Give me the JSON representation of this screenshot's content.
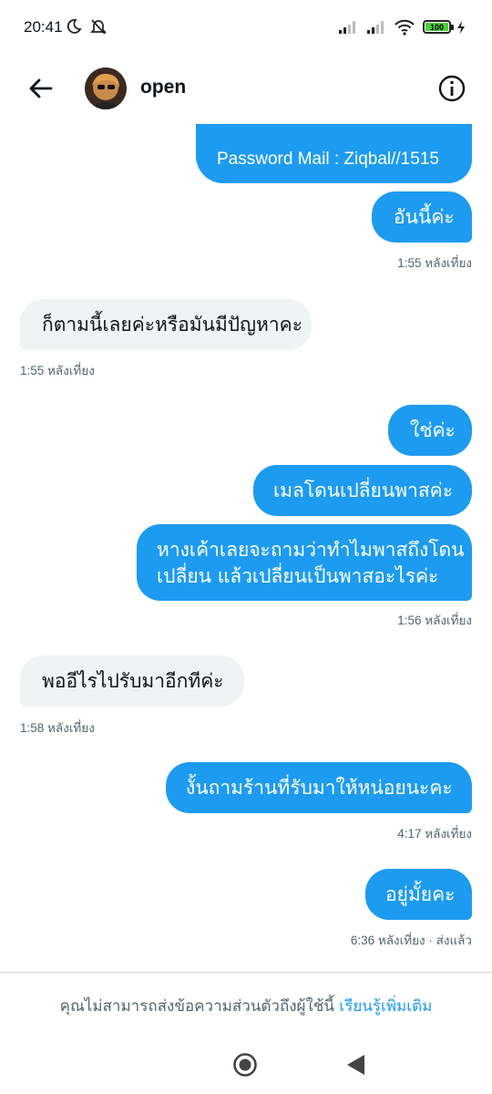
{
  "status_bar": {
    "time": "20:41",
    "battery": "100"
  },
  "header": {
    "contact_name": "open"
  },
  "messages": [
    {
      "text": "Password Mail : Ziqbal//1515"
    },
    {
      "text": "อันนี้ค่ะ"
    },
    {
      "time": "1:55 หลังเที่ยง"
    },
    {
      "text": "ก็ตามนี้เลยค่ะหรือมันมีปัญหาคะ"
    },
    {
      "time": "1:55 หลังเที่ยง"
    },
    {
      "text": "ใช่ค่ะ"
    },
    {
      "text": "เมลโดนเปลี่ยนพาสค่ะ"
    },
    {
      "line1": "หางเค้าเลยจะถามว่าทำไมพาสถึงโดน",
      "line2": "เปลี่ยน แล้วเปลี่ยนเป็นพาสอะไรค่ะ"
    },
    {
      "time": "1:56 หลังเที่ยง"
    },
    {
      "text": "พออีไรไปรับมาอีกทีค่ะ"
    },
    {
      "time": "1:58 หลังเที่ยง"
    },
    {
      "text": "งั้นถามร้านที่รับมาให้หน่อยนะคะ"
    },
    {
      "time": "4:17 หลังเที่ยง"
    },
    {
      "text": "อยู่มั้ยคะ"
    },
    {
      "time": "6:36 หลังเที่ยง · ส่งแล้ว"
    }
  ],
  "footer": {
    "notice": "คุณไม่สามารถส่งข้อความส่วนตัวถึงผู้ใช้นี้",
    "learn_more": "เรียนรู้เพิ่มเติม"
  },
  "colors": {
    "accent": "#1d9bf0",
    "incoming_bubble": "#eff3f4",
    "timestamp": "#536471"
  },
  "icons": {
    "back": "arrow-left-icon",
    "info": "info-circle-icon",
    "home": "home-circle-icon",
    "nav_back": "triangle-back-icon"
  }
}
